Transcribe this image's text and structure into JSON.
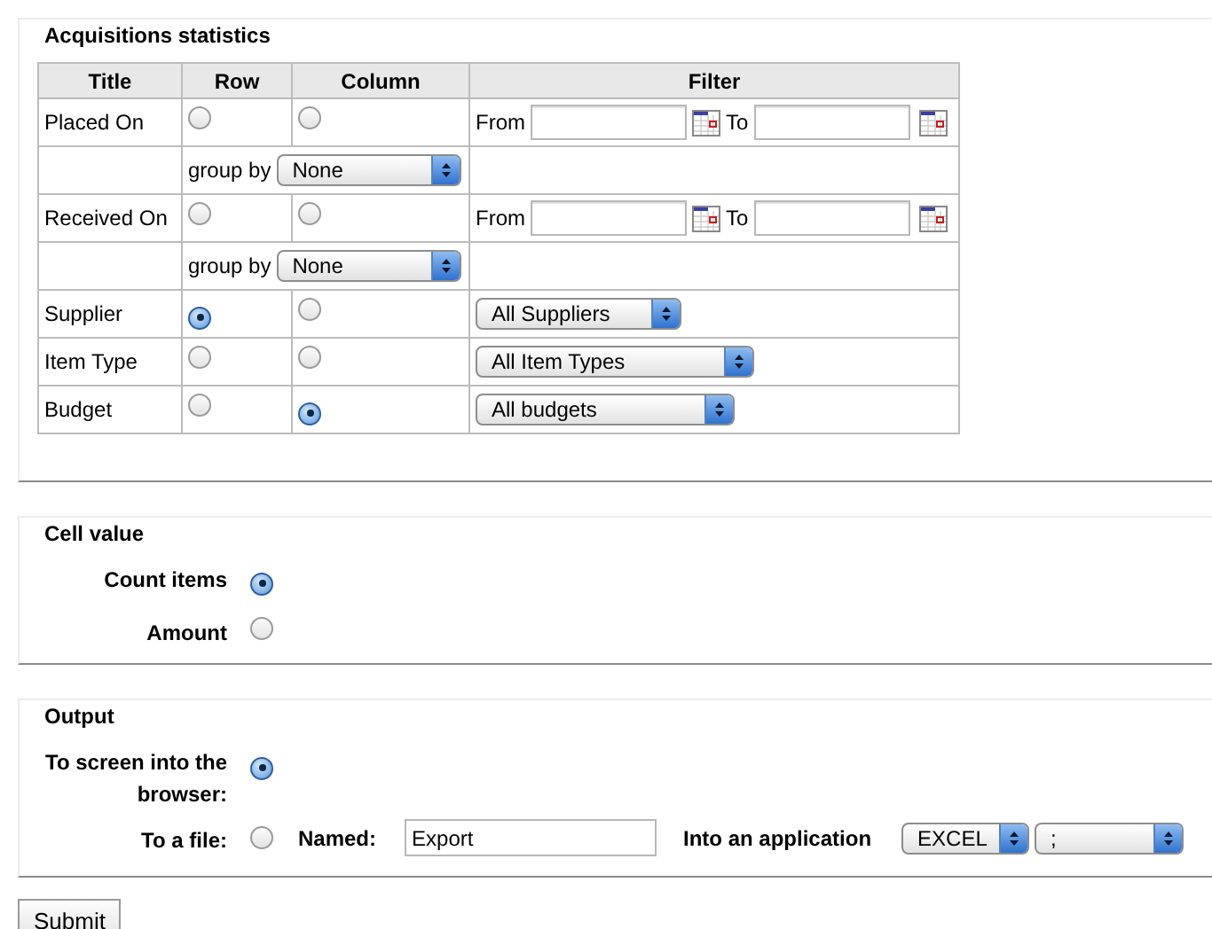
{
  "statistics": {
    "title": "Acquisitions statistics",
    "columns": [
      "Title",
      "Row",
      "Column",
      "Filter"
    ],
    "rows": [
      {
        "kind": "date",
        "title": "Placed On",
        "row_selected": false,
        "column_selected": false,
        "from_label": "From",
        "to_label": "To",
        "group_by_label": "group by",
        "group_by": "None"
      },
      {
        "kind": "date",
        "title": "Received On",
        "row_selected": false,
        "column_selected": false,
        "from_label": "From",
        "to_label": "To",
        "group_by_label": "group by",
        "group_by": "None"
      },
      {
        "kind": "select",
        "title": "Supplier",
        "row_selected": true,
        "column_selected": false,
        "filter": "All Suppliers"
      },
      {
        "kind": "select",
        "title": "Item Type",
        "row_selected": false,
        "column_selected": false,
        "filter": "All Item Types"
      },
      {
        "kind": "select",
        "title": "Budget",
        "row_selected": false,
        "column_selected": true,
        "filter": "All budgets"
      }
    ]
  },
  "cell_value": {
    "title": "Cell value",
    "options": [
      {
        "label": "Count items",
        "selected": true
      },
      {
        "label": "Amount",
        "selected": false
      }
    ]
  },
  "output": {
    "title": "Output",
    "options": [
      {
        "kind": "screen",
        "label": "To screen into the browser:",
        "selected": true
      },
      {
        "kind": "file",
        "label": "To a file:",
        "selected": false,
        "named_label": "Named:",
        "file_name": "Export",
        "application_label": "Into an application",
        "application": "EXCEL",
        "separator": ";"
      }
    ]
  },
  "submit": "Submit"
}
